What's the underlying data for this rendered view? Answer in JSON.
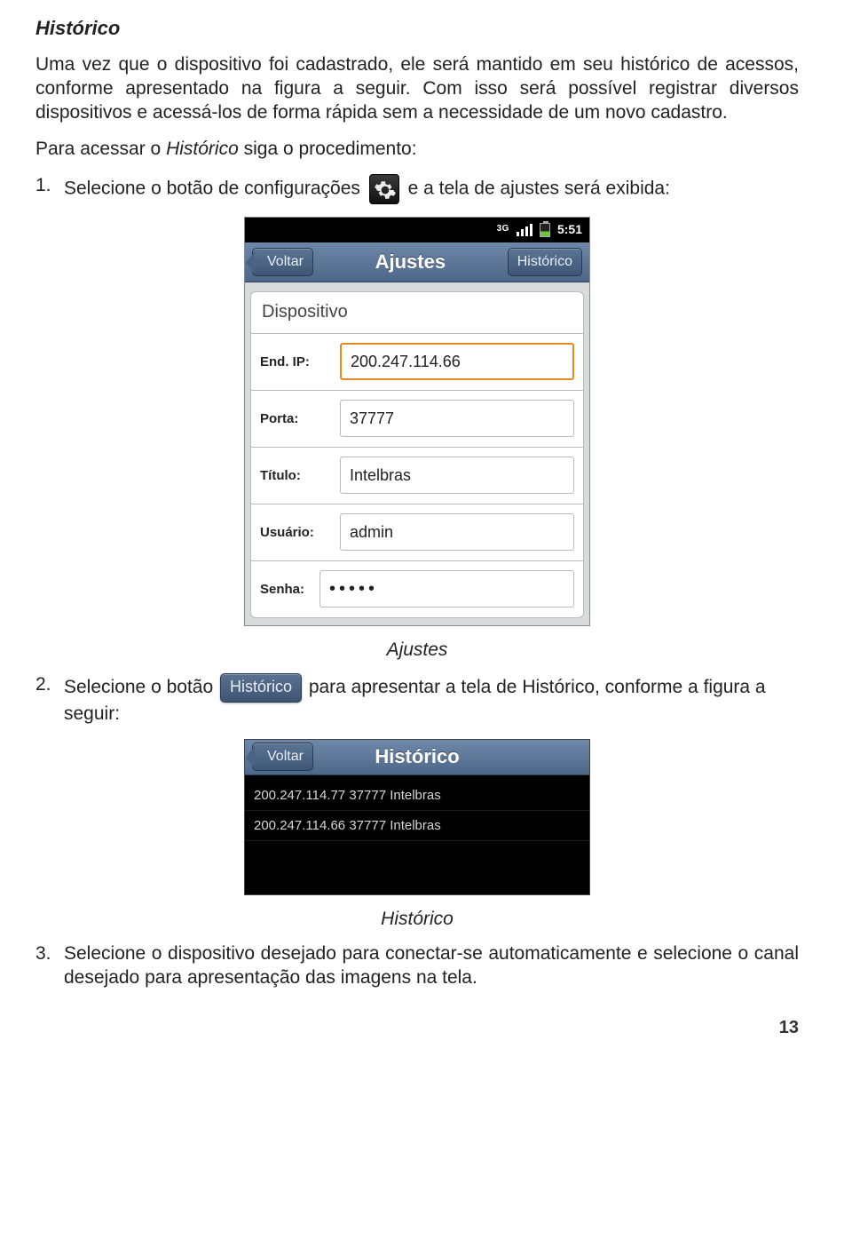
{
  "heading": "Histórico",
  "para1": "Uma vez que o dispositivo foi cadastrado, ele será mantido em seu histórico de acessos, conforme apresentado na figura a seguir. Com isso será possível registrar diversos dispositivos e acessá-los de forma rápida sem a necessidade de um novo cadastro.",
  "para2_a": "Para acessar o ",
  "para2_b": "Histórico",
  "para2_c": " siga o procedimento:",
  "step1_num": "1.",
  "step1_a": "Selecione o botão de configurações ",
  "step1_b": " e a tela de ajustes será exibida:",
  "caption1": "Ajustes",
  "step2_num": "2.",
  "step2_a": "Selecione o botão ",
  "step2_btn": "Histórico",
  "step2_b": " para apresentar a tela de ",
  "step2_c": "Histórico",
  "step2_d": ", conforme a figura a seguir:",
  "caption2": "Histórico",
  "step3_num": "3.",
  "step3": "Selecione o dispositivo desejado para conectar-se automaticamente e selecione o canal desejado para apresentação das imagens na tela.",
  "page_number": "13",
  "ajustes_screen": {
    "status_time": "5:51",
    "status_net": "3G",
    "nav_back": "Voltar",
    "nav_title": "Ajustes",
    "nav_right": "Histórico",
    "section": "Dispositivo",
    "fields": {
      "ip_label": "End. IP:",
      "ip_value": "200.247.114.66",
      "port_label": "Porta:",
      "port_value": "37777",
      "title_label": "Título:",
      "title_value": "Intelbras",
      "user_label": "Usuário:",
      "user_value": "admin",
      "pwd_label": "Senha:",
      "pwd_value": "•••••"
    }
  },
  "historico_screen": {
    "nav_back": "Voltar",
    "nav_title": "Histórico",
    "rows": [
      "200.247.114.77 37777 Intelbras",
      "200.247.114.66 37777 Intelbras"
    ]
  }
}
